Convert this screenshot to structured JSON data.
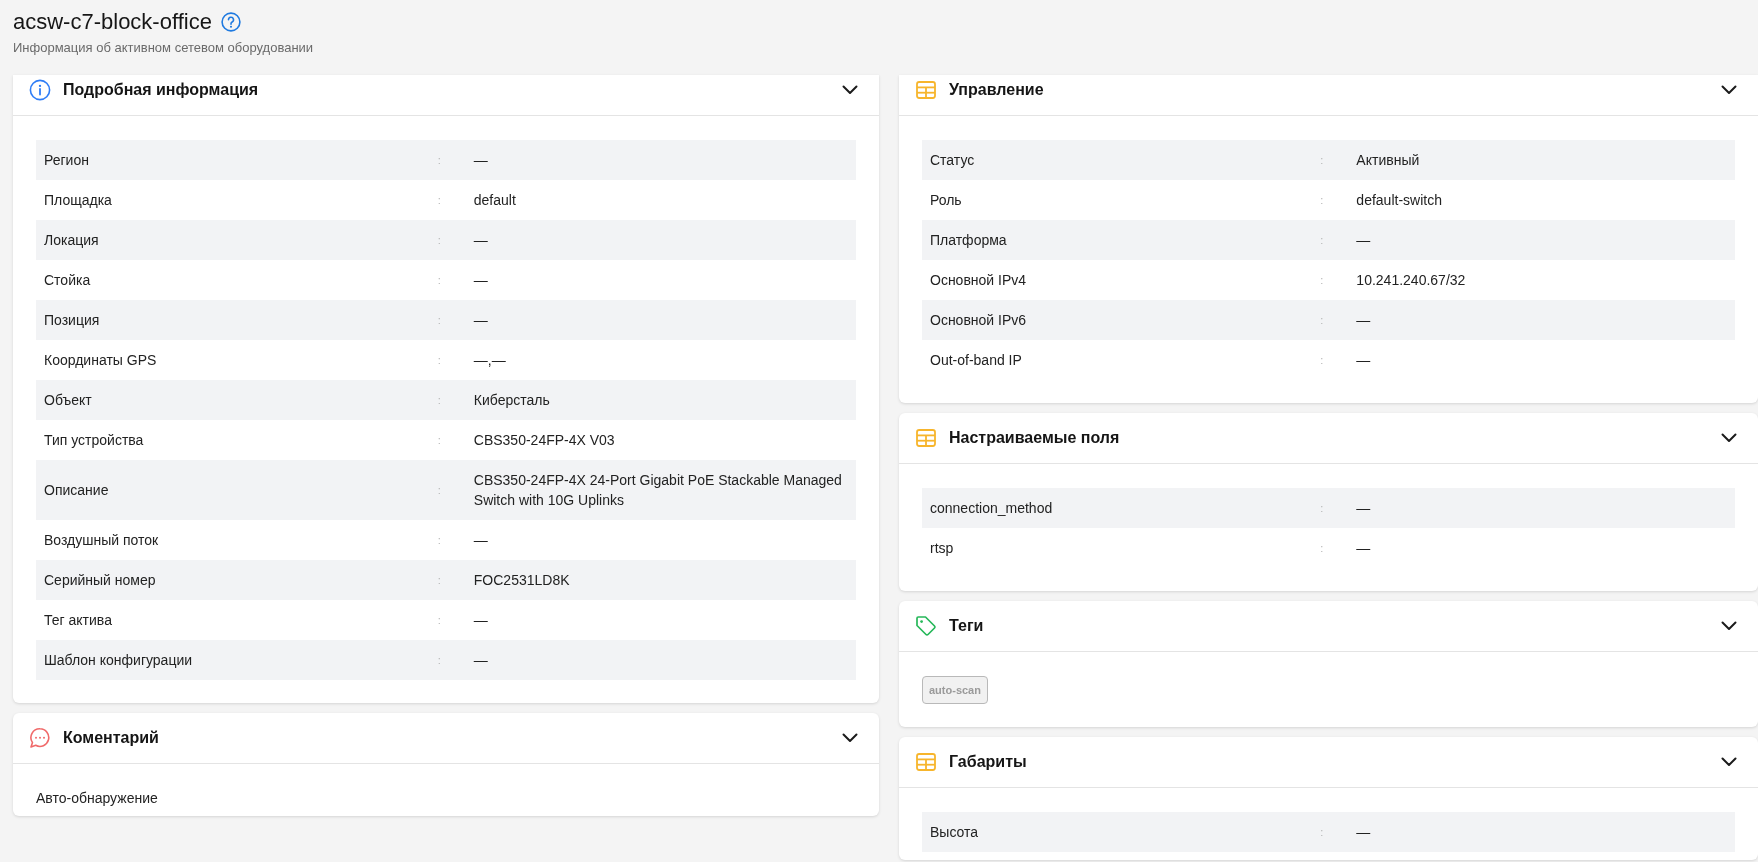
{
  "page": {
    "title": "acsw-c7-block-office",
    "subtitle": "Информация об активном сетевом оборудовании"
  },
  "columns": [
    {
      "cards": [
        {
          "kind": "details",
          "title": "Подробная информация",
          "expanded": true,
          "rows": [
            {
              "label": "Регион",
              "separator": ":",
              "value": "—"
            },
            {
              "label": "Площадка",
              "separator": ":",
              "value": "default"
            },
            {
              "label": "Локация",
              "separator": ":",
              "value": "—"
            },
            {
              "label": "Стойка",
              "separator": ":",
              "value": "—"
            },
            {
              "label": "Позиция",
              "separator": ":",
              "value": "—"
            },
            {
              "label": "Координаты GPS",
              "separator": ":",
              "value": "—,—"
            },
            {
              "label": "Объект",
              "separator": ":",
              "value": "Киберсталь"
            },
            {
              "label": "Тип устройства",
              "separator": ":",
              "value": "CBS350-24FP-4X V03"
            },
            {
              "label": "Описание",
              "separator": ":",
              "value": "CBS350-24FP-4X 24-Port Gigabit PoE Stackable Managed Switch with 10G Uplinks"
            },
            {
              "label": "Воздушный поток",
              "separator": ":",
              "value": "—"
            },
            {
              "label": "Серийный номер",
              "separator": ":",
              "value": "FOC2531LD8K"
            },
            {
              "label": "Тег актива",
              "separator": ":",
              "value": "—"
            },
            {
              "label": "Шаблон конфигурации",
              "separator": ":",
              "value": "—"
            }
          ]
        },
        {
          "kind": "comment",
          "title": "Коментарий",
          "expanded": true,
          "text": "Авто-обнаружение"
        }
      ]
    },
    {
      "cards": [
        {
          "kind": "fields",
          "title": "Управление",
          "expanded": true,
          "rows": [
            {
              "label": "Статус",
              "separator": ":",
              "value": "Активный"
            },
            {
              "label": "Роль",
              "separator": ":",
              "value": "default-switch"
            },
            {
              "label": "Платформа",
              "separator": ":",
              "value": "—"
            },
            {
              "label": "Основной IPv4",
              "separator": ":",
              "value": "10.241.240.67/32"
            },
            {
              "label": "Основной IPv6",
              "separator": ":",
              "value": "—"
            },
            {
              "label": "Out-of-band IP",
              "separator": ":",
              "value": "—"
            }
          ]
        },
        {
          "kind": "fields",
          "title": "Настраиваемые поля",
          "expanded": true,
          "rows": [
            {
              "label": "connection_method",
              "separator": ":",
              "value": "—"
            },
            {
              "label": "rtsp",
              "separator": ":",
              "value": "—"
            }
          ]
        },
        {
          "kind": "tags",
          "title": "Теги",
          "expanded": true,
          "tags": [
            {
              "label": "auto-scan"
            }
          ]
        },
        {
          "kind": "fields",
          "title": "Габариты",
          "expanded": true,
          "rows": [
            {
              "label": "Высота",
              "separator": ":",
              "value": "—"
            }
          ]
        }
      ]
    }
  ]
}
